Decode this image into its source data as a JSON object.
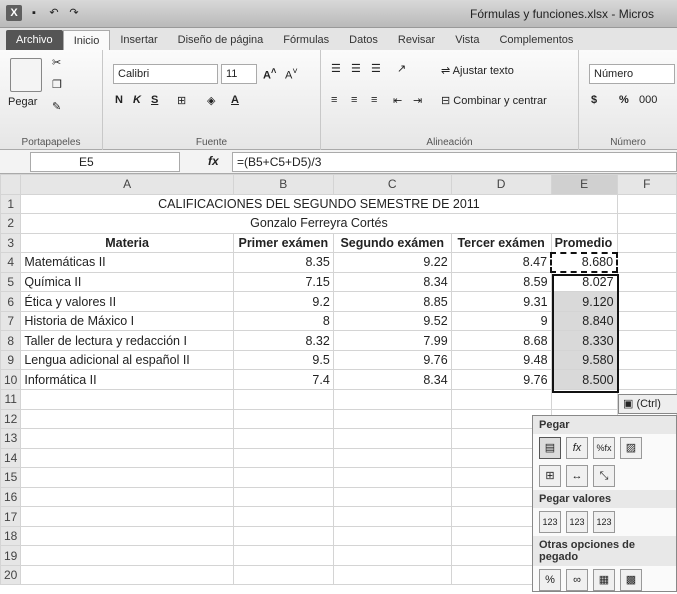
{
  "window": {
    "title": "Fórmulas y funciones.xlsx - Micros"
  },
  "tabs": [
    "Archivo",
    "Inicio",
    "Insertar",
    "Diseño de página",
    "Fórmulas",
    "Datos",
    "Revisar",
    "Vista",
    "Complementos"
  ],
  "ribbon": {
    "paste_label": "Pegar",
    "font_name": "Calibri",
    "font_size": "11",
    "bold": "N",
    "italic": "K",
    "underline": "S",
    "wrap_text": "Ajustar texto",
    "merge_center": "Combinar y centrar",
    "number_format": "Número",
    "currency": "$",
    "percent": "%",
    "thousands": "000",
    "groups": {
      "clipboard": "Portapapeles",
      "font": "Fuente",
      "alignment": "Alineación",
      "number": "Número"
    }
  },
  "formula_bar": {
    "name_box": "E5",
    "fx": "fx",
    "formula": "=(B5+C5+D5)/3"
  },
  "columns": [
    "A",
    "B",
    "C",
    "D",
    "E",
    "F"
  ],
  "rows": [
    "1",
    "2",
    "3",
    "4",
    "5",
    "6",
    "7",
    "8",
    "9",
    "10",
    "11",
    "12",
    "13",
    "14",
    "15",
    "16",
    "17",
    "18",
    "19",
    "20"
  ],
  "sheet": {
    "title": "CALIFICACIONES DEL SEGUNDO SEMESTRE DE 2011",
    "student": "Gonzalo Ferreyra Cortés",
    "headers": [
      "Materia",
      "Primer exámen",
      "Segundo exámen",
      "Tercer exámen",
      "Promedio"
    ],
    "data": [
      [
        "Matemáticas II",
        "8.35",
        "9.22",
        "8.47",
        "8.680"
      ],
      [
        "Química II",
        "7.15",
        "8.34",
        "8.59",
        "8.027"
      ],
      [
        "Ética y valores II",
        "9.2",
        "8.85",
        "9.31",
        "9.120"
      ],
      [
        "Historia de Máxico I",
        "8",
        "9.52",
        "9",
        "8.840"
      ],
      [
        "Taller de lectura y redacción I",
        "8.32",
        "7.99",
        "8.68",
        "8.330"
      ],
      [
        "Lengua adicional al español II",
        "9.5",
        "9.76",
        "9.48",
        "9.580"
      ],
      [
        "Informática II",
        "7.4",
        "8.34",
        "9.76",
        "8.500"
      ]
    ]
  },
  "paste_options": {
    "ctrl_label": "(Ctrl)",
    "sections": [
      "Pegar",
      "Pegar valores",
      "Otras opciones de pegado"
    ],
    "paste_icons": [
      "fx",
      "%fx"
    ],
    "value_icons": [
      "123",
      "123",
      "123"
    ],
    "other_icons": [
      "%"
    ]
  }
}
